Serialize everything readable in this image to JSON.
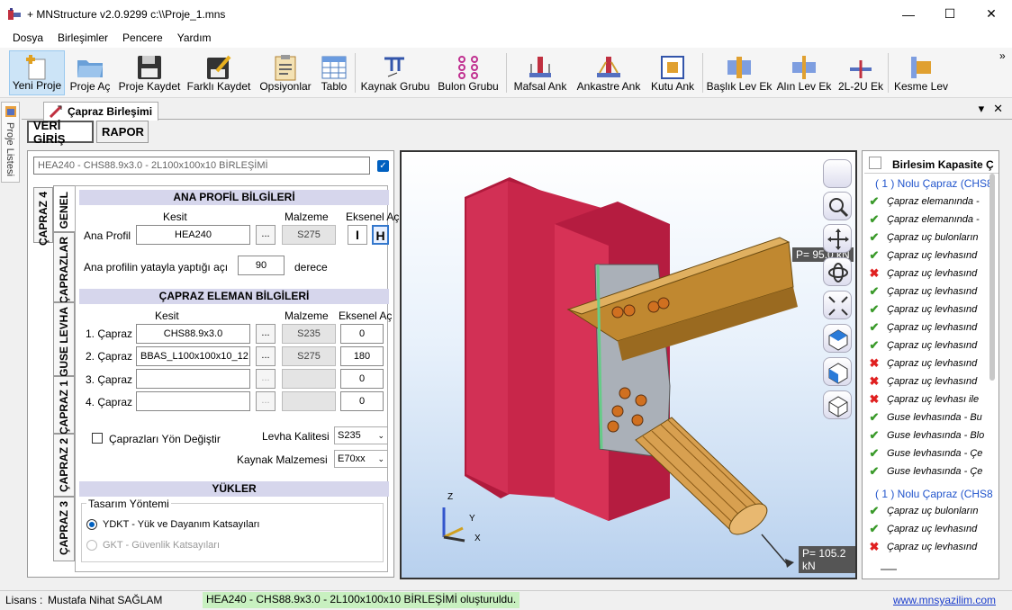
{
  "window": {
    "title": "+ MNStructure v2.0.9299   c:\\\\Proje_1.mns",
    "minimize": "—",
    "maximize": "☐",
    "close": "✕"
  },
  "menu": [
    "Dosya",
    "Birleşimler",
    "Pencere",
    "Yardım"
  ],
  "toolbar": {
    "items": [
      "Yeni Proje",
      "Proje Aç",
      "Proje Kaydet",
      "Farklı Kaydet",
      "Opsiyonlar",
      "Tablo",
      "Kaynak Grubu",
      "Bulon Grubu",
      "Mafsal Ank",
      "Ankastre Ank",
      "Kutu Ank",
      "Başlık Lev Ek",
      "Alın Lev Ek",
      "2L-2U Ek",
      "Kesme Lev"
    ],
    "overflow": "»"
  },
  "side_panel": {
    "label": "Proje Listesi"
  },
  "doc_tab": {
    "title": "Çapraz Birleşimi",
    "pin": "▾",
    "close": "✕"
  },
  "subtabs": {
    "input": "VERİ GİRİŞ",
    "report": "RAPOR"
  },
  "left": {
    "title_value": "HEA240 - CHS88.9x3.0 - 2L100x100x10 BİRLEŞİMİ",
    "vtabs": [
      "GENEL",
      "ÇAPRAZ 4",
      "ÇAPRAZLAR",
      "GUSE LEVHA",
      "ÇAPRAZ 1",
      "ÇAPRAZ 2",
      "ÇAPRAZ 3"
    ],
    "ana_profil": {
      "header": "ANA PROFİL BİLGİLERİ",
      "col_kesit": "Kesit",
      "col_malzeme": "Malzeme",
      "col_eksenel": "Eksenel Aç",
      "label": "Ana Profil",
      "kesit": "HEA240",
      "malzeme": "S275",
      "dots": "...",
      "icon_i": "I",
      "icon_h": "H",
      "angle_label": "Ana profilin yatayla yaptığı açı",
      "angle_value": "90",
      "angle_unit": "derece"
    },
    "capraz": {
      "header": "ÇAPRAZ ELEMAN BİLGİLERİ",
      "col_kesit": "Kesit",
      "col_malzeme": "Malzeme",
      "col_eksenel": "Eksenel Aç",
      "rows": [
        {
          "label": "1. Çapraz",
          "kesit": "CHS88.9x3.0",
          "malzeme": "S235",
          "aci": "0"
        },
        {
          "label": "2. Çapraz",
          "kesit": "BBAS_L100x100x10_12",
          "malzeme": "S275",
          "aci": "180"
        },
        {
          "label": "3. Çapraz",
          "kesit": "",
          "malzeme": "",
          "aci": "0"
        },
        {
          "label": "4. Çapraz",
          "kesit": "",
          "malzeme": "",
          "aci": "0"
        }
      ],
      "reverse_label": "Çaprazları Yön Değiştir",
      "levha_label": "Levha Kalitesi",
      "levha_value": "S235",
      "kaynak_label": "Kaynak Malzemesi",
      "kaynak_value": "E70xx"
    },
    "yukler": {
      "header": "YÜKLER",
      "group": "Tasarım Yöntemi",
      "opt1": "YDKT - Yük ve Dayanım Katsayıları",
      "opt2": "GKT - Güvenlik Katsayıları"
    }
  },
  "view": {
    "load1": "P= 95.0 kN",
    "load2": "P= 105.2 kN",
    "axes": {
      "z": "Z",
      "y": "Y",
      "x": "X"
    }
  },
  "right": {
    "header": "Birlesim Kapasite Ç",
    "group1": "( 1 ) Nolu Çapraz (CHS8",
    "items1": [
      {
        "text": "Çapraz elemanında -",
        "ok": true
      },
      {
        "text": "Çapraz elemanında -",
        "ok": true
      },
      {
        "text": "Çapraz uç bulonların",
        "ok": true
      },
      {
        "text": "Çapraz uç levhasınd",
        "ok": true
      },
      {
        "text": "Çapraz uç levhasınd",
        "ok": false
      },
      {
        "text": "Çapraz uç levhasınd",
        "ok": true
      },
      {
        "text": "Çapraz uç levhasınd",
        "ok": true
      },
      {
        "text": "Çapraz uç levhasınd",
        "ok": true
      },
      {
        "text": "Çapraz uç levhasınd",
        "ok": true
      },
      {
        "text": "Çapraz uç levhasınd",
        "ok": false
      },
      {
        "text": "Çapraz uç levhasınd",
        "ok": false
      },
      {
        "text": "Çapraz uç levhası ile",
        "ok": false
      },
      {
        "text": "Guse levhasında - Bu",
        "ok": true
      },
      {
        "text": "Guse levhasında - Blo",
        "ok": true
      },
      {
        "text": "Guse levhasında - Çe",
        "ok": true
      },
      {
        "text": "Guse levhasında - Çe",
        "ok": true
      }
    ],
    "group2": "( 1 ) Nolu Çapraz (CHS8",
    "items2": [
      {
        "text": "Çapraz uç bulonların",
        "ok": true
      },
      {
        "text": "Çapraz uç levhasınd",
        "ok": true
      },
      {
        "text": "Çapraz uç levhasınd",
        "ok": false
      }
    ]
  },
  "status": {
    "license_label": "Lisans :",
    "license_name": "Mustafa Nihat SAĞLAM",
    "message": "HEA240 - CHS88.9x3.0 - 2L100x100x10 BİRLEŞİMİ oluşturuldu.",
    "link": "www.mnsyazilim.com"
  }
}
